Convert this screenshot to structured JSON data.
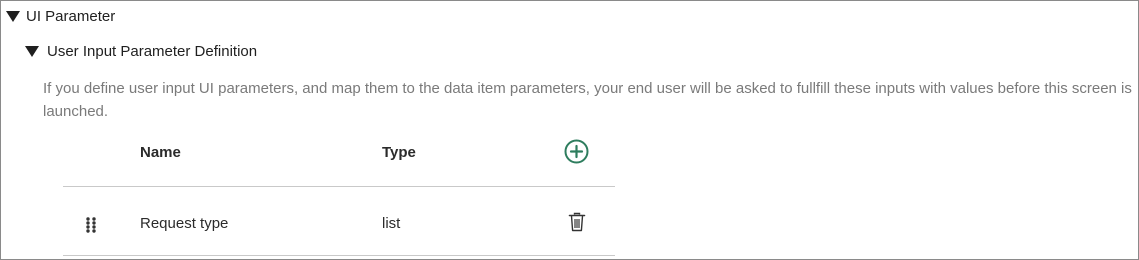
{
  "section": {
    "title": "UI Parameter",
    "expanded": true,
    "icon": "caret-down-icon"
  },
  "subsection": {
    "title": "User Input Parameter Definition",
    "expanded": true,
    "icon": "caret-down-icon"
  },
  "description": "If you define user input UI parameters, and map them to the data item parameters, your end user will be asked to fullfill these inputs with values before this screen is launched.",
  "table": {
    "columns": [
      "Name",
      "Type"
    ],
    "add_icon": "plus-circle-icon",
    "rows": [
      {
        "name": "Request type",
        "type": "list",
        "drag_icon": "drag-handle-icon",
        "delete_icon": "trash-icon"
      }
    ]
  },
  "colors": {
    "accent": "#2e7d5e",
    "text": "#2b2b2b",
    "muted": "#7a7a7a",
    "divider": "#c9c9c9"
  }
}
